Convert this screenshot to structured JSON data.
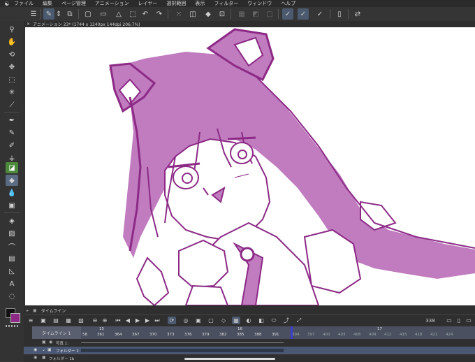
{
  "menu": {
    "items": [
      "ファイル",
      "編集",
      "ページ管理",
      "アニメーション",
      "レイヤー",
      "選択範囲",
      "表示",
      "フィルター",
      "ウィンドウ",
      "ヘルプ"
    ]
  },
  "document": {
    "tab_title": "アニメーション 23* (1744 x 1240px 144dpi 206.7%)"
  },
  "timeline": {
    "panel_title": "タイムライン",
    "current_frame": "338",
    "timeline_name": "タイムライン 1",
    "section_markers": [
      "15",
      "16",
      "17"
    ],
    "frames_left": [
      "58",
      "361",
      "364",
      "367",
      "370",
      "373",
      "376",
      "379",
      "382",
      "385",
      "388",
      "391"
    ],
    "frames_right": [
      "394",
      "397",
      "400",
      "403",
      "406",
      "409",
      "412",
      "415",
      "418",
      "421",
      "424"
    ],
    "layers": [
      {
        "name": "写真 1:"
      },
      {
        "name": "フォルダー 1"
      },
      {
        "name": "フォルダー 1b"
      }
    ]
  },
  "colors": {
    "accent": "#4a8a3a",
    "sketch": "#8c2a86",
    "fill": "#c07cbf"
  }
}
